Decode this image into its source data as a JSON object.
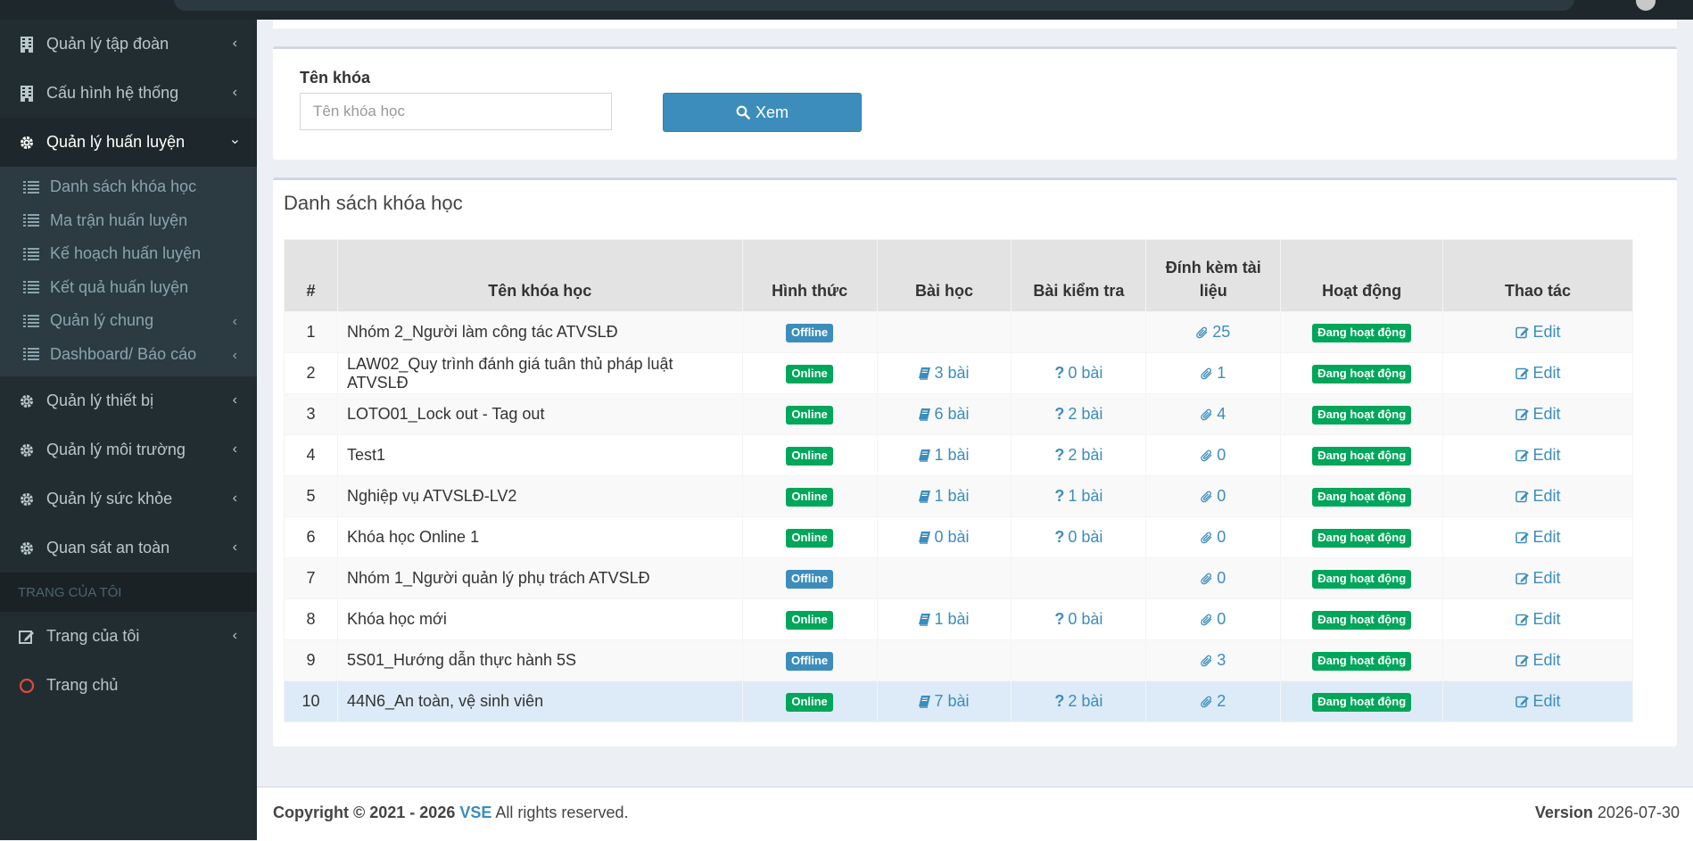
{
  "sidebar": {
    "items_top": [
      {
        "label": "Quản lý tập đoàn",
        "icon": "building-icon"
      },
      {
        "label": "Cấu hình hệ thống",
        "icon": "building-icon"
      },
      {
        "label": "Quản lý huấn luyện",
        "icon": "gear-icon"
      }
    ],
    "sub_items": [
      {
        "label": "Danh sách khóa học"
      },
      {
        "label": "Ma trận huấn luyện"
      },
      {
        "label": "Kế hoạch huấn luyện"
      },
      {
        "label": "Kết quả huấn luyện"
      },
      {
        "label": "Quản lý chung"
      },
      {
        "label": "Dashboard/ Báo cáo"
      }
    ],
    "items_bottom": [
      {
        "label": "Quản lý thiết bị"
      },
      {
        "label": "Quản lý môi trường"
      },
      {
        "label": "Quản lý sức khỏe"
      },
      {
        "label": "Quan sát an toàn"
      }
    ],
    "section_header": "TRANG CỦA TÔI",
    "my_page": "Trang của tôi",
    "home": "Trang chủ"
  },
  "filter": {
    "label": "Tên khóa",
    "placeholder": "Tên khóa học",
    "value": "",
    "button": "Xem"
  },
  "list": {
    "title": "Danh sách khóa học",
    "columns": [
      "#",
      "Tên khóa học",
      "Hình thức",
      "Bài học",
      "Bài kiểm tra",
      "Đính kèm tài liệu",
      "Hoạt động",
      "Thao tác"
    ],
    "rows": [
      {
        "no": "1",
        "name": "Nhóm 2_Người làm công tác ATVSLĐ",
        "mode": "Offline",
        "lessons": "",
        "tests": "",
        "attach": "25",
        "status": "Đang hoạt động",
        "action": "Edit"
      },
      {
        "no": "2",
        "name": "LAW02_Quy trình đánh giá tuân thủ pháp luật ATVSLĐ",
        "mode": "Online",
        "lessons": "3 bài",
        "tests": "0 bài",
        "attach": "1",
        "status": "Đang hoạt động",
        "action": "Edit"
      },
      {
        "no": "3",
        "name": "LOTO01_Lock out - Tag out",
        "mode": "Online",
        "lessons": "6 bài",
        "tests": "2 bài",
        "attach": "4",
        "status": "Đang hoạt động",
        "action": "Edit"
      },
      {
        "no": "4",
        "name": "Test1",
        "mode": "Online",
        "lessons": "1 bài",
        "tests": "2 bài",
        "attach": "0",
        "status": "Đang hoạt động",
        "action": "Edit"
      },
      {
        "no": "5",
        "name": "Nghiệp vụ ATVSLĐ-LV2",
        "mode": "Online",
        "lessons": "1 bài",
        "tests": "1 bài",
        "attach": "0",
        "status": "Đang hoạt động",
        "action": "Edit"
      },
      {
        "no": "6",
        "name": "Khóa học Online 1",
        "mode": "Online",
        "lessons": "0 bài",
        "tests": "0 bài",
        "attach": "0",
        "status": "Đang hoạt động",
        "action": "Edit"
      },
      {
        "no": "7",
        "name": "Nhóm 1_Người quản lý phụ trách ATVSLĐ",
        "mode": "Offline",
        "lessons": "",
        "tests": "",
        "attach": "0",
        "status": "Đang hoạt động",
        "action": "Edit"
      },
      {
        "no": "8",
        "name": "Khóa học mới",
        "mode": "Online",
        "lessons": "1 bài",
        "tests": "0 bài",
        "attach": "0",
        "status": "Đang hoạt động",
        "action": "Edit"
      },
      {
        "no": "9",
        "name": "5S01_Hướng dẫn thực hành 5S",
        "mode": "Offline",
        "lessons": "",
        "tests": "",
        "attach": "3",
        "status": "Đang hoạt động",
        "action": "Edit"
      },
      {
        "no": "10",
        "name": "44N6_An toàn, vệ sinh viên",
        "mode": "Online",
        "lessons": "7 bài",
        "tests": "2 bài",
        "attach": "2",
        "status": "Đang hoạt động",
        "action": "Edit"
      }
    ]
  },
  "footer": {
    "copyright_prefix": "Copyright © 2021 - 2026",
    "brand": "VSE",
    "copyright_suffix": "All rights reserved.",
    "version_label": "Version",
    "version_value": "2026-07-30"
  },
  "colors": {
    "primary": "#3c8dbc",
    "success": "#00a65a",
    "sidebar": "#222d32"
  }
}
